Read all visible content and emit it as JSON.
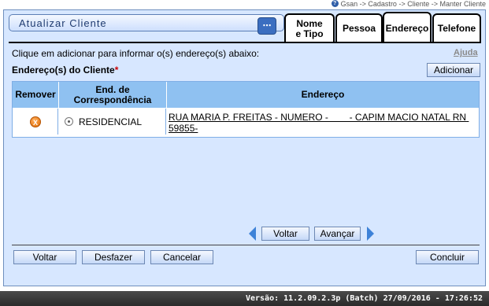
{
  "breadcrumb": "Gsan -> Cadastro -> Cliente -> Manter Cliente",
  "title": "Atualizar Cliente",
  "tabs": [
    {
      "label_line1": "Nome",
      "label_line2": "e Tipo"
    },
    {
      "label": "Pessoa"
    },
    {
      "label": "Endereço"
    },
    {
      "label": "Telefone"
    }
  ],
  "active_tab": "Endereço",
  "instruction": "Clique em adicionar para informar o(s) endereço(s) abaixo:",
  "help_link": "Ajuda",
  "section_label": "Endereço(s) do Cliente",
  "required_mark": "*",
  "add_button": "Adicionar",
  "table": {
    "headers": {
      "remove": "Remover",
      "correspondence_line1": "End. de",
      "correspondence_line2": "Correspondência",
      "address": "Endereço"
    },
    "rows": [
      {
        "remove_icon": "X",
        "correspondence": "RESIDENCIAL",
        "address": "RUA MARIA P. FREITAS - NUMERO -        - CAPIM MACIO NATAL RN 59855-"
      }
    ]
  },
  "nav": {
    "back": "Voltar",
    "forward": "Avançar"
  },
  "footer_buttons": {
    "back": "Voltar",
    "undo": "Desfazer",
    "cancel": "Cancelar",
    "finish": "Concluir"
  },
  "version": "Versão: 11.2.09.2.3p (Batch) 27/09/2016 - 17:26:52",
  "colors": {
    "panel": "#d7e7ff",
    "table_header": "#8fc1f1",
    "accent": "#3d82d8",
    "version_bar": "#333333"
  }
}
